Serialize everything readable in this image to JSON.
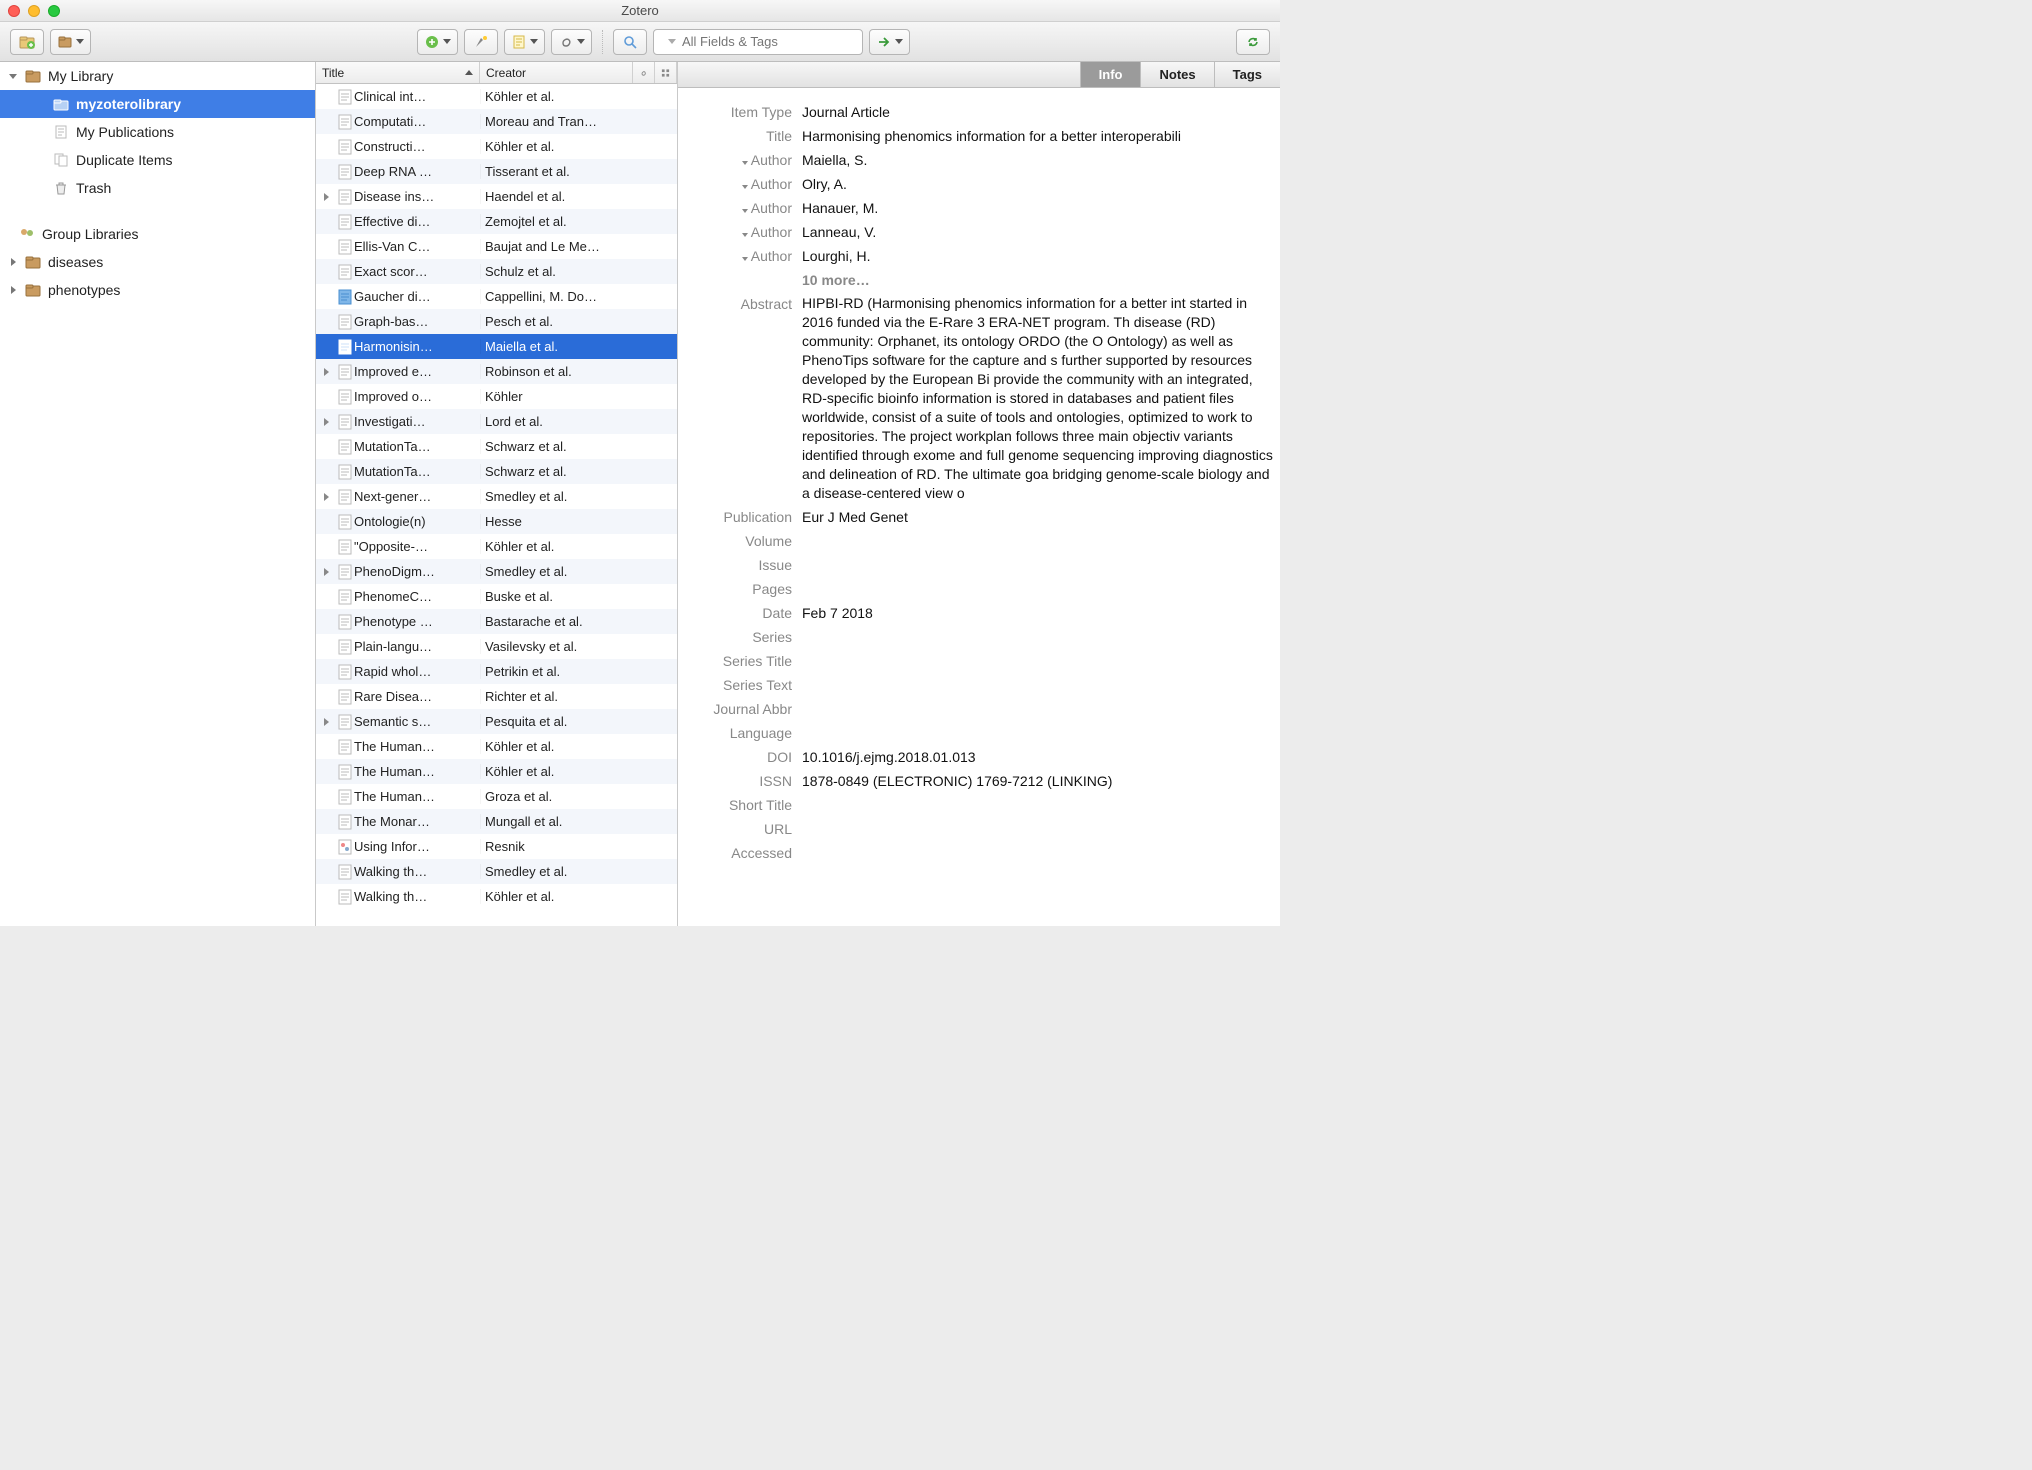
{
  "window": {
    "title": "Zotero"
  },
  "toolbar": {
    "search_placeholder": "All Fields & Tags"
  },
  "sidebar": {
    "my_library": "My Library",
    "items": [
      {
        "label": "myzoterolibrary",
        "icon": "folder",
        "selected": true
      },
      {
        "label": "My Publications",
        "icon": "pub"
      },
      {
        "label": "Duplicate Items",
        "icon": "dup"
      },
      {
        "label": "Trash",
        "icon": "trash"
      }
    ],
    "group_header": "Group Libraries",
    "groups": [
      {
        "label": "diseases"
      },
      {
        "label": "phenotypes"
      }
    ]
  },
  "columns": {
    "title": "Title",
    "creator": "Creator"
  },
  "items": [
    {
      "title": "Clinical int…",
      "creator": "Köhler et al.",
      "expandable": false
    },
    {
      "title": "Computati…",
      "creator": "Moreau and Tran…",
      "expandable": false
    },
    {
      "title": "Constructi…",
      "creator": "Köhler et al.",
      "expandable": false
    },
    {
      "title": "Deep RNA …",
      "creator": "Tisserant et al.",
      "expandable": false
    },
    {
      "title": "Disease ins…",
      "creator": "Haendel et al.",
      "expandable": true
    },
    {
      "title": "Effective di…",
      "creator": "Zemojtel et al.",
      "expandable": false
    },
    {
      "title": "Ellis-Van C…",
      "creator": "Baujat and Le Me…",
      "expandable": false
    },
    {
      "title": "Exact scor…",
      "creator": "Schulz et al.",
      "expandable": false
    },
    {
      "title": "Gaucher di…",
      "creator": "Cappellini, M. Do…",
      "expandable": false,
      "icon": "blue"
    },
    {
      "title": "Graph-bas…",
      "creator": "Pesch et al.",
      "expandable": false
    },
    {
      "title": "Harmonisin…",
      "creator": "Maiella et al.",
      "expandable": false,
      "selected": true
    },
    {
      "title": "Improved e…",
      "creator": "Robinson et al.",
      "expandable": true
    },
    {
      "title": "Improved o…",
      "creator": "Köhler",
      "expandable": false
    },
    {
      "title": "Investigati…",
      "creator": "Lord et al.",
      "expandable": true
    },
    {
      "title": "MutationTa…",
      "creator": "Schwarz et al.",
      "expandable": false
    },
    {
      "title": "MutationTa…",
      "creator": "Schwarz et al.",
      "expandable": false
    },
    {
      "title": "Next-gener…",
      "creator": "Smedley et al.",
      "expandable": true
    },
    {
      "title": "Ontologie(n)",
      "creator": "Hesse",
      "expandable": false
    },
    {
      "title": "\"Opposite-…",
      "creator": "Köhler et al.",
      "expandable": false
    },
    {
      "title": "PhenoDigm…",
      "creator": "Smedley et al.",
      "expandable": true
    },
    {
      "title": "PhenomeC…",
      "creator": "Buske et al.",
      "expandable": false
    },
    {
      "title": "Phenotype …",
      "creator": "Bastarache et al.",
      "expandable": false
    },
    {
      "title": "Plain-langu…",
      "creator": "Vasilevsky et al.",
      "expandable": false
    },
    {
      "title": "Rapid whol…",
      "creator": "Petrikin et al.",
      "expandable": false
    },
    {
      "title": "Rare Disea…",
      "creator": "Richter et al.",
      "expandable": false
    },
    {
      "title": "Semantic s…",
      "creator": "Pesquita et al.",
      "expandable": true
    },
    {
      "title": "The Human…",
      "creator": "Köhler et al.",
      "expandable": false
    },
    {
      "title": "The Human…",
      "creator": "Köhler et al.",
      "expandable": false
    },
    {
      "title": "The Human…",
      "creator": "Groza et al.",
      "expandable": false
    },
    {
      "title": "The Monar…",
      "creator": "Mungall et al.",
      "expandable": false
    },
    {
      "title": "Using Infor…",
      "creator": "Resnik",
      "expandable": false,
      "icon": "colored"
    },
    {
      "title": "Walking th…",
      "creator": "Smedley et al.",
      "expandable": false
    },
    {
      "title": "Walking th…",
      "creator": "Köhler et al.",
      "expandable": false
    }
  ],
  "tabs": {
    "info": "Info",
    "notes": "Notes",
    "tags": "Tags"
  },
  "details": {
    "item_type_label": "Item Type",
    "item_type": "Journal Article",
    "title_label": "Title",
    "title": "Harmonising phenomics information for a better interoperabili",
    "author_label": "Author",
    "authors": [
      "Maiella, S.",
      "Olry, A.",
      "Hanauer, M.",
      "Lanneau, V.",
      "Lourghi, H."
    ],
    "more_authors": "10 more…",
    "abstract_label": "Abstract",
    "abstract": "HIPBI-RD (Harmonising phenomics information for a better int started in 2016 funded via the E-Rare 3 ERA-NET program. Th disease (RD) community: Orphanet, its ontology ORDO (the O Ontology) as well as PhenoTips software for the capture and s further supported by resources developed by the European Bi provide the community with an integrated, RD-specific bioinfo information is stored in databases and patient files worldwide, consist of a suite of tools and ontologies, optimized to work to repositories. The project workplan follows three main objectiv variants identified through exome and full genome sequencing improving diagnostics and delineation of RD. The ultimate goa bridging genome-scale biology and a disease-centered view o",
    "publication_label": "Publication",
    "publication": "Eur J Med Genet",
    "volume_label": "Volume",
    "issue_label": "Issue",
    "pages_label": "Pages",
    "date_label": "Date",
    "date": "Feb 7 2018",
    "series_label": "Series",
    "series_title_label": "Series Title",
    "series_text_label": "Series Text",
    "journal_abbr_label": "Journal Abbr",
    "language_label": "Language",
    "doi_label": "DOI",
    "doi": "10.1016/j.ejmg.2018.01.013",
    "issn_label": "ISSN",
    "issn": "1878-0849 (ELECTRONIC) 1769-7212 (LINKING)",
    "short_title_label": "Short Title",
    "url_label": "URL",
    "accessed_label": "Accessed"
  }
}
